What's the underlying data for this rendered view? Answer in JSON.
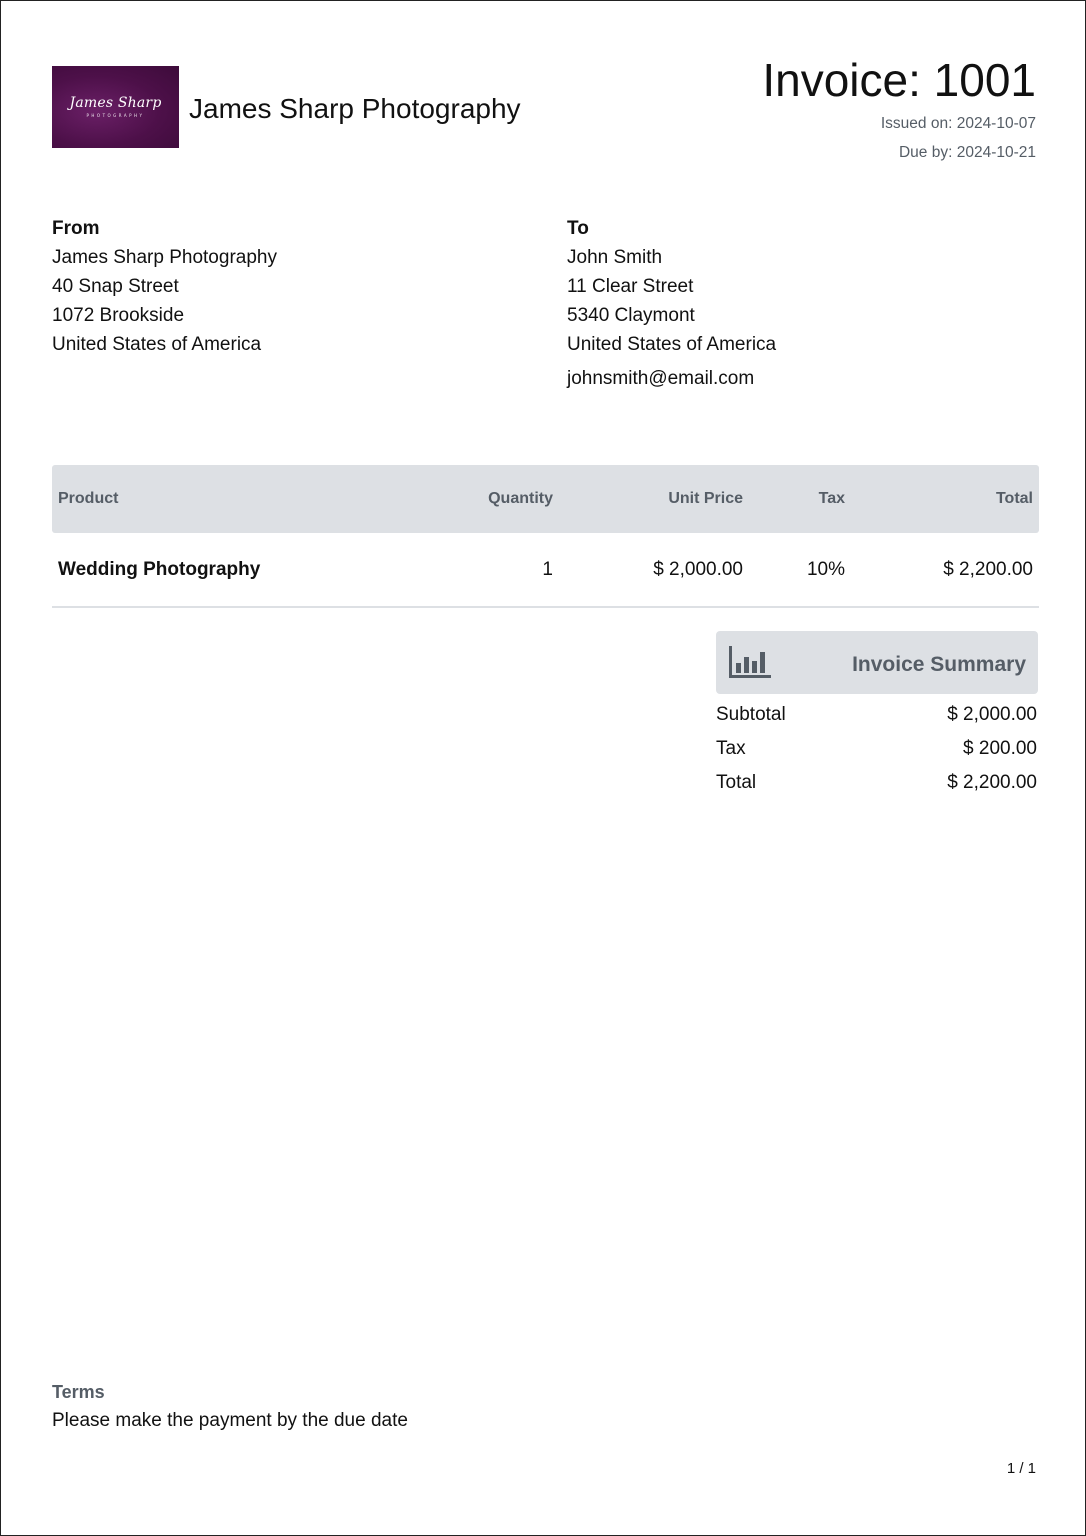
{
  "header": {
    "logo_script": "James Sharp",
    "logo_sub": "PHOTOGRAPHY",
    "company_name": "James Sharp Photography",
    "invoice_title": "Invoice: 1001",
    "issued": "Issued on: 2024-10-07",
    "due": "Due by: 2024-10-21"
  },
  "from": {
    "heading": "From",
    "lines": [
      "James Sharp Photography",
      "40 Snap Street",
      "1072 Brookside",
      "United States of America"
    ]
  },
  "to": {
    "heading": "To",
    "lines": [
      "John Smith",
      "11 Clear Street",
      "5340 Claymont",
      "United States of America"
    ],
    "email": "johnsmith@email.com"
  },
  "table": {
    "headers": {
      "product": "Product",
      "quantity": "Quantity",
      "unit_price": "Unit Price",
      "tax": "Tax",
      "total": "Total"
    },
    "rows": [
      {
        "product": "Wedding Photography",
        "quantity": "1",
        "unit_price": "$ 2,000.00",
        "tax": "10%",
        "total": "$ 2,200.00"
      }
    ]
  },
  "summary": {
    "title": "Invoice Summary",
    "icon": "bar-chart-icon",
    "rows": [
      {
        "label": "Subtotal",
        "value": "$ 2,000.00"
      },
      {
        "label": "Tax",
        "value": "$ 200.00"
      },
      {
        "label": "Total",
        "value": "$ 2,200.00"
      }
    ]
  },
  "terms": {
    "heading": "Terms",
    "text": "Please make the payment by the due date"
  },
  "footer": {
    "page": "1 / 1"
  },
  "colors": {
    "logo_bg": "#4d1049",
    "header_bg": "#dde0e4",
    "muted_text": "#555d66"
  }
}
